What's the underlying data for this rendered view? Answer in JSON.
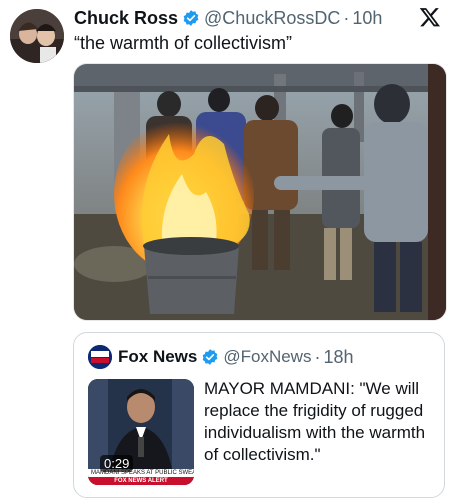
{
  "tweet": {
    "author_name": "Chuck Ross",
    "author_handle": "@ChuckRossDC",
    "separator": "·",
    "time": "10h",
    "text": "“the warmth of collectivism”"
  },
  "quoted_tweet": {
    "author_name": "Fox News",
    "author_handle": "@FoxNews",
    "separator": "·",
    "time": "18h",
    "text": "MAYOR MAMDANI: \"We will replace the frigidity of rugged individualism with the warmth of collectivism.\"",
    "video": {
      "duration": "0:29",
      "chyron": "MAMDANI SPEAKS AT PUBLIC SWEARING-IN",
      "live_tag": "FOX NEWS ALERT"
    }
  },
  "colors": {
    "text_primary": "#0f1419",
    "text_secondary": "#536471",
    "verified_blue": "#1d9bf0",
    "border": "#cfd9de"
  },
  "icons": {
    "verified": "verified-badge-icon",
    "platform": "x-logo-icon",
    "quoted_avatar": "fox-news-logo-icon"
  }
}
